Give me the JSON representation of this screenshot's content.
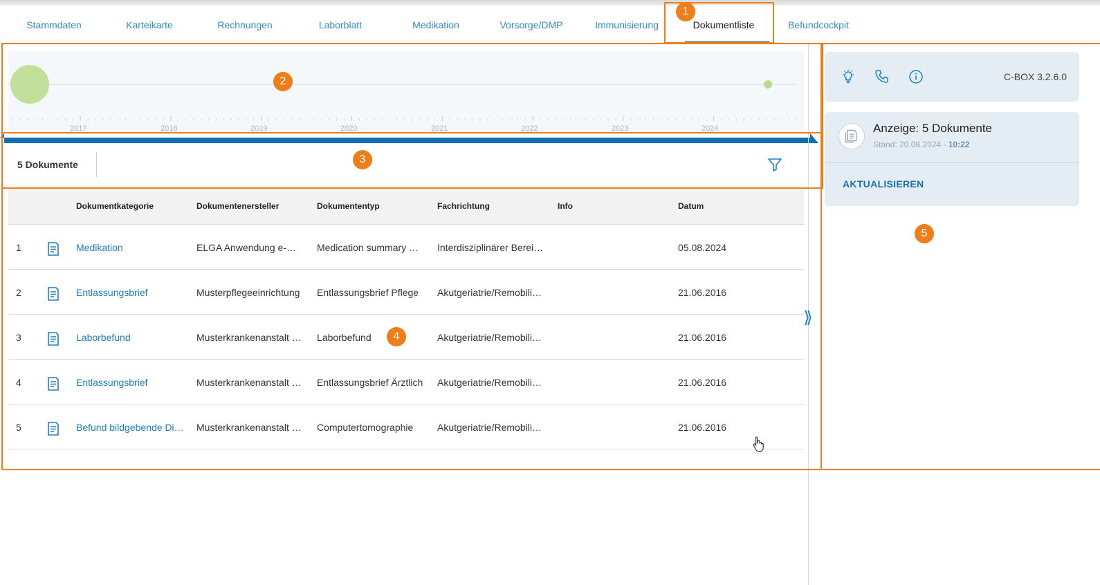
{
  "tabs": [
    {
      "label": "Stammdaten",
      "active": false
    },
    {
      "label": "Karteikarte",
      "active": false
    },
    {
      "label": "Rechnungen",
      "active": false
    },
    {
      "label": "Laborblatt",
      "active": false
    },
    {
      "label": "Medikation",
      "active": false
    },
    {
      "label": "Vorsorge/DMP",
      "active": false
    },
    {
      "label": "Immunisierung",
      "active": false
    },
    {
      "label": "Dokumentliste",
      "active": true
    },
    {
      "label": "Befundcockpit",
      "active": false
    }
  ],
  "annotations": [
    "1",
    "2",
    "3",
    "4",
    "5"
  ],
  "timeline": {
    "years": [
      "2017",
      "2018",
      "2019",
      "2020",
      "2021",
      "2022",
      "2023",
      "2024"
    ]
  },
  "toolbar": {
    "doc_count": "5 Dokumente",
    "filter_icon": "filter-icon"
  },
  "table": {
    "headers": [
      "Dokumentkategorie",
      "Dokumentenersteller",
      "Dokumententyp",
      "Fachrichtung",
      "Info",
      "Datum"
    ],
    "rows": [
      {
        "num": "1",
        "category": "Medikation",
        "creator": "ELGA Anwendung e-Medikation",
        "type": "Medication summary document",
        "specialty": "Interdisziplinärer Bereich",
        "info": "",
        "date": "05.08.2024"
      },
      {
        "num": "2",
        "category": "Entlassungsbrief",
        "creator": "Musterpflegeeinrichtung",
        "type": "Entlassungsbrief Pflege",
        "specialty": "Akutgeriatrie/Remobilisation",
        "info": "",
        "date": "21.06.2016"
      },
      {
        "num": "3",
        "category": "Laborbefund",
        "creator": "Musterkrankenanstalt Graz",
        "type": "Laborbefund",
        "specialty": "Akutgeriatrie/Remobilisation",
        "info": "",
        "date": "21.06.2016"
      },
      {
        "num": "4",
        "category": "Entlassungsbrief",
        "creator": "Musterkrankenanstalt Graz",
        "type": "Entlassungsbrief Ärztlich",
        "specialty": "Akutgeriatrie/Remobilisation",
        "info": "",
        "date": "21.06.2016"
      },
      {
        "num": "5",
        "category": "Befund bildgebende Diagnostik",
        "creator": "Musterkrankenanstalt Graz",
        "type": "Computertomographie",
        "specialty": "Akutgeriatrie/Remobilisation",
        "info": "",
        "date": "21.06.2016"
      }
    ]
  },
  "panel": {
    "icons": [
      "lightbulb-icon",
      "phone-icon",
      "info-icon"
    ],
    "version": "C-BOX 3.2.6.0",
    "title": "Anzeige: 5 Dokumente",
    "stand_prefix": "Stand: 20.08.2024 - ",
    "stand_time": "10:22",
    "refresh_label": "AKTUALISIEREN"
  },
  "colors": {
    "accent": "#1b7fc3",
    "annotation": "#ef7d1a",
    "timeline_bar": "#0e6fb5",
    "panel_bg": "#e4edf4",
    "bubble": "#b9dc8a"
  }
}
